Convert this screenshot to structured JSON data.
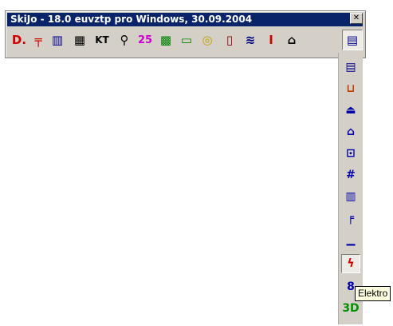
{
  "window": {
    "title": "SkiJo - 18.0 euvztp pro Windows, 30.09.2004",
    "close_glyph": "✕"
  },
  "toolbar": [
    {
      "icon": "d-icon",
      "glyph": "D.",
      "color": "#d00000"
    },
    {
      "icon": "pipe-icon",
      "glyph": "╤",
      "color": "#d00000"
    },
    {
      "icon": "column-icon",
      "glyph": "▥",
      "color": "#00008b"
    },
    {
      "icon": "building-icon",
      "glyph": "▦",
      "color": "#000000"
    },
    {
      "icon": "kt-icon",
      "glyph": "KT",
      "color": "#000000"
    },
    {
      "icon": "magnifier-icon",
      "glyph": "⚲",
      "color": "#000000"
    },
    {
      "icon": "number-25-icon",
      "glyph": "25",
      "color": "#cc00cc"
    },
    {
      "icon": "grid-icon",
      "glyph": "▩",
      "color": "#008000"
    },
    {
      "icon": "window-icon",
      "glyph": "▭",
      "color": "#008000"
    },
    {
      "icon": "target-icon",
      "glyph": "◎",
      "color": "#c0a000"
    },
    {
      "icon": "door-icon",
      "glyph": "▯",
      "color": "#8b0000"
    },
    {
      "icon": "layers-icon",
      "glyph": "≋",
      "color": "#000080"
    },
    {
      "icon": "i-beam-icon",
      "glyph": "I",
      "color": "#d00000"
    },
    {
      "icon": "roof-icon",
      "glyph": "⌂",
      "color": "#000000"
    },
    {
      "icon": "wall-icon",
      "glyph": "▤",
      "color": "#00008b"
    }
  ],
  "flyout": [
    {
      "icon": "wall-icon",
      "glyph": "▤",
      "color": "#00008b"
    },
    {
      "icon": "trough-icon",
      "glyph": "⊔",
      "color": "#c04000"
    },
    {
      "icon": "sink-icon",
      "glyph": "⏏",
      "color": "#0000aa"
    },
    {
      "icon": "roof-icon",
      "glyph": "⌂",
      "color": "#0000aa"
    },
    {
      "icon": "panel-icon",
      "glyph": "⊡",
      "color": "#0000aa"
    },
    {
      "icon": "fence-icon",
      "glyph": "#",
      "color": "#0000aa"
    },
    {
      "icon": "radiator-icon",
      "glyph": "▥",
      "color": "#0000aa"
    },
    {
      "icon": "faucet-icon",
      "glyph": "╒",
      "color": "#0000aa"
    },
    {
      "icon": "heater-icon",
      "glyph": "▁",
      "color": "#0000aa"
    },
    {
      "icon": "lightning-icon",
      "glyph": "ϟ",
      "color": "#d00000"
    },
    {
      "icon": "eight-icon",
      "glyph": "8",
      "color": "#0000aa"
    },
    {
      "icon": "3d-icon",
      "glyph": "3D",
      "color": "#009000"
    }
  ],
  "tooltip": {
    "text": "Elektro"
  }
}
